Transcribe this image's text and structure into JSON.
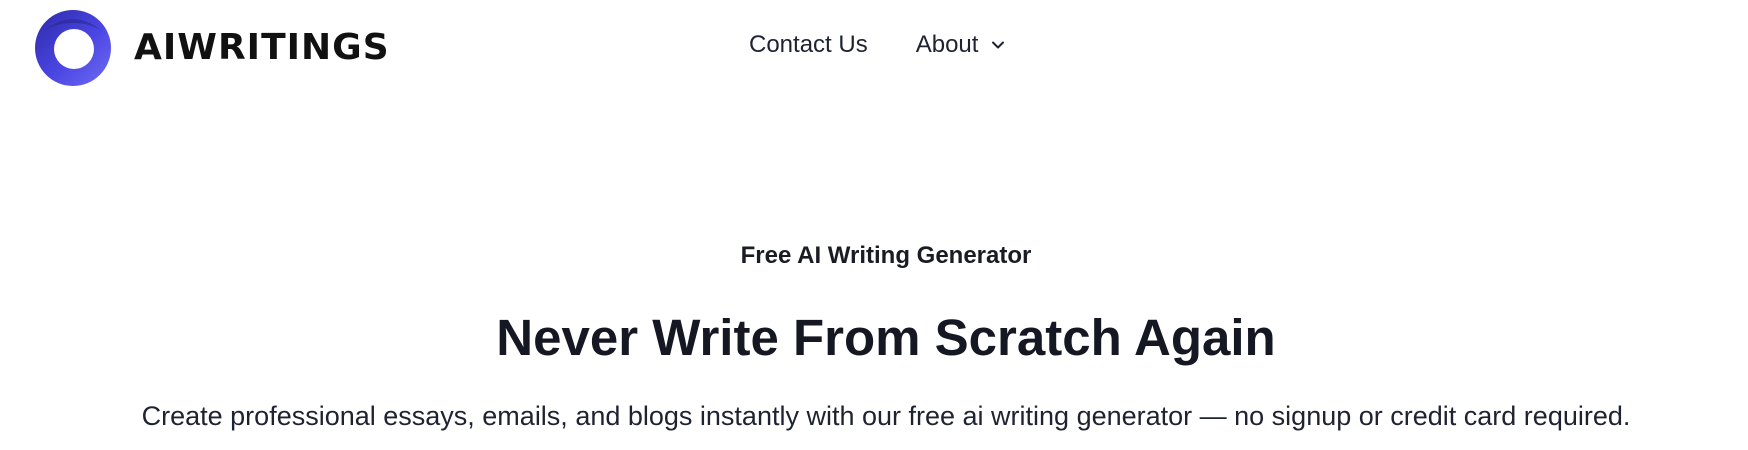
{
  "brand": {
    "name": "AIWRITINGS",
    "logo_icon": "ring-logo-icon",
    "accent": "#4b46e3"
  },
  "nav": {
    "contact_label": "Contact Us",
    "about_label": "About",
    "about_icon": "chevron-down-icon"
  },
  "hero": {
    "eyebrow": "Free AI Writing Generator",
    "headline": "Never Write From Scratch Again",
    "subtitle": "Create professional essays, emails, and blogs instantly with our free ai writing generator — no signup or credit card required."
  }
}
